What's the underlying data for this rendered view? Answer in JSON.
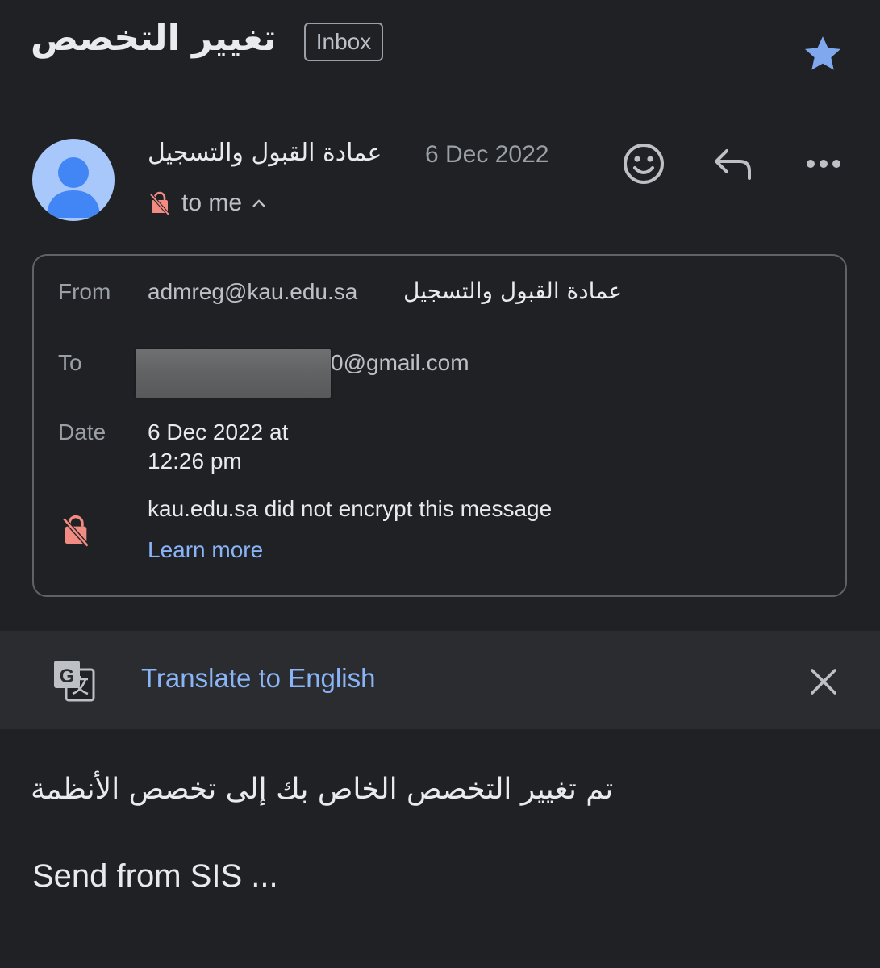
{
  "email": {
    "subject": "تغيير التخصص",
    "label": "Inbox",
    "sender_name": "عمادة القبول والتسجيل",
    "date_short": "6 Dec 2022",
    "recipient_summary": "to me"
  },
  "details": {
    "from_label": "From",
    "from_email": "admreg@kau.edu.sa",
    "from_name": "عمادة القبول والتسجيل",
    "to_label": "To",
    "to_visible_suffix": "0@gmail.com",
    "date_label": "Date",
    "date_line1": "6 Dec 2022 at",
    "date_line2": "12:26 pm",
    "encryption_notice": "kau.edu.sa did not encrypt this message",
    "learn_more": "Learn more"
  },
  "translate": {
    "label": "Translate to English"
  },
  "body": {
    "arabic_line": "تم تغيير التخصص الخاص بك إلى تخصص الأنظمة",
    "footer_line": "Send from SIS ..."
  },
  "icons": {
    "star": "star-icon",
    "avatar": "person-icon",
    "emoji": "emoji-icon",
    "reply": "reply-icon",
    "more": "more-horizontal-icon",
    "lock": "unencrypted-lock-icon",
    "chevron": "chevron-up-icon",
    "translate": "translate-icon",
    "close": "close-icon"
  },
  "colors": {
    "background": "#202124",
    "accent": "#8ab4f8",
    "star": "#7fa8ee",
    "warning": "#f28b82",
    "translate_bar": "#2b2c2f"
  }
}
